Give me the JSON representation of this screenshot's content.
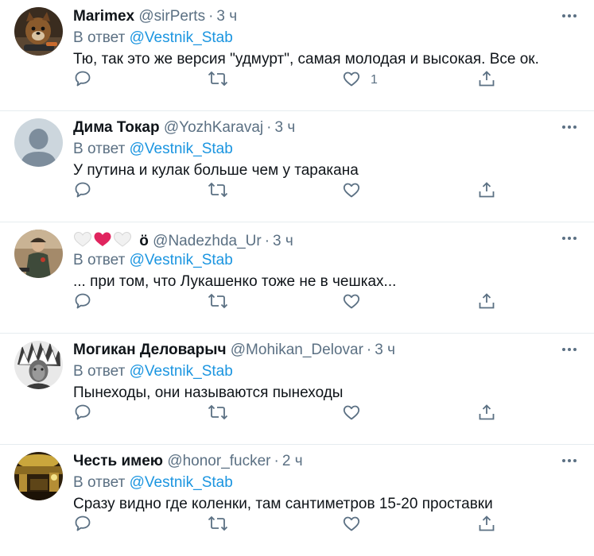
{
  "reply_prefix": "В ответ",
  "colors": {
    "text": "#0f1419",
    "secondary": "#5b7083",
    "link": "#1b95e0",
    "divider": "#e6ecf0",
    "heart_red": "#e0245e"
  },
  "action_icons": [
    "reply-icon",
    "retweet-icon",
    "like-icon",
    "share-icon"
  ],
  "tweets": [
    {
      "name": "Marimex",
      "handle": "@sirPerts",
      "time": "3 ч",
      "reply_to": "@Vestnik_Stab",
      "text": "Тю, так это же версия \"удмурт\", самая молодая и высокая. Все ок.",
      "like_count": "1"
    },
    {
      "name": "Дима Токар",
      "handle": "@YozhKaravaj",
      "time": "3 ч",
      "reply_to": "@Vestnik_Stab",
      "text": "У путина и кулак больше чем у таракана",
      "like_count": ""
    },
    {
      "name": "ö",
      "name_emoji": [
        "white-heart",
        "red-heart",
        "white-heart"
      ],
      "handle": "@Nadezhda_Ur",
      "time": "3 ч",
      "reply_to": "@Vestnik_Stab",
      "text": "... при том, что Лукашенко тоже не в чешках...",
      "like_count": ""
    },
    {
      "name": "Могикан Деловарыч",
      "handle": "@Mohikan_Delovar",
      "time": "3 ч",
      "reply_to": "@Vestnik_Stab",
      "text": "Пынеходы, они называются пынеходы",
      "like_count": ""
    },
    {
      "name": "Честь имею",
      "handle": "@honor_fucker",
      "time": "2 ч",
      "reply_to": "@Vestnik_Stab",
      "text": "Сразу видно где коленки, там сантиметров 15-20 проставки",
      "like_count": ""
    }
  ]
}
